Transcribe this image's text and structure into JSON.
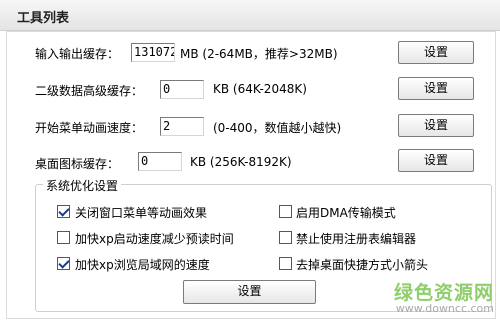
{
  "window": {
    "title": "工具列表"
  },
  "rows": [
    {
      "label": "输入输出缓存：",
      "value": "131072",
      "hint": "MB  (2-64MB，推荐>32MB)",
      "button": "设置"
    },
    {
      "label": "二级数据高级缓存：",
      "value": "0",
      "hint": "KB  (64K-2048K)",
      "button": "设置"
    },
    {
      "label": "开始菜单动画速度：",
      "value": "2",
      "hint": "(0-400，数值越小越快)",
      "button": "设置"
    },
    {
      "label": "桌面图标缓存：",
      "value": "0",
      "hint": "KB  (256K-8192K)",
      "button": "设置"
    }
  ],
  "optimize": {
    "legend": "系统优化设置",
    "options": [
      {
        "label": "关闭窗口菜单等动画效果",
        "checked": true
      },
      {
        "label": "启用DMA传输模式",
        "checked": false
      },
      {
        "label": "加快xp启动速度减少预读时间",
        "checked": false
      },
      {
        "label": "禁止使用注册表编辑器",
        "checked": false
      },
      {
        "label": "加快xp浏览局域网的速度",
        "checked": true
      },
      {
        "label": "去掉桌面快捷方式小箭头",
        "checked": false
      }
    ],
    "button": "设置"
  },
  "watermark": {
    "brand": "绿色资源网",
    "url": "www.downcc.com"
  }
}
